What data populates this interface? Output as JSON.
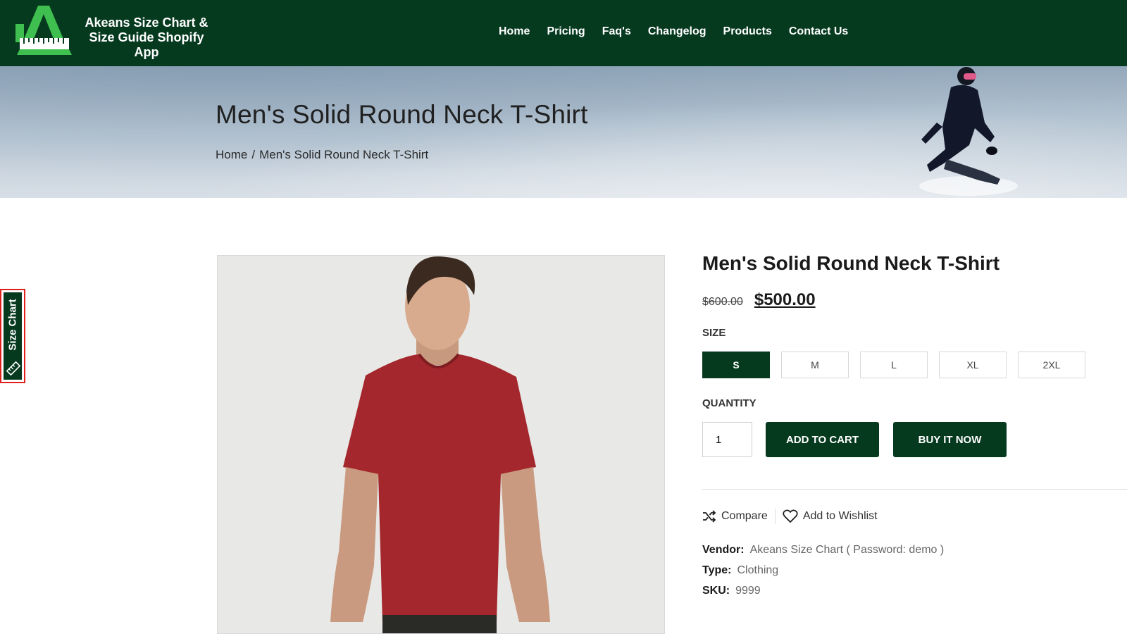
{
  "header": {
    "logo_line1": "Akeans Size Chart &",
    "logo_line2": "Size Guide Shopify App",
    "nav": [
      "Home",
      "Pricing",
      "Faq's",
      "Changelog",
      "Products",
      "Contact Us"
    ]
  },
  "banner": {
    "title": "Men's Solid Round Neck T-Shirt",
    "breadcrumb_home": "Home",
    "breadcrumb_sep": "/",
    "breadcrumb_current": "Men's Solid Round Neck T-Shirt"
  },
  "size_chart_tab": {
    "label": "Size Chart"
  },
  "product": {
    "title": "Men's Solid Round Neck T-Shirt",
    "old_price": "$600.00",
    "price": "$500.00",
    "size_label": "SIZE",
    "sizes": [
      "S",
      "M",
      "L",
      "XL",
      "2XL"
    ],
    "selected_size": "S",
    "quantity_label": "QUANTITY",
    "quantity": "1",
    "add_to_cart": "ADD TO CART",
    "buy_now": "BUY IT NOW",
    "compare": "Compare",
    "wishlist": "Add to Wishlist",
    "vendor_label": "Vendor:",
    "vendor": "Akeans Size Chart ( Password: demo )",
    "type_label": "Type:",
    "type": "Clothing",
    "sku_label": "SKU:",
    "sku": "9999"
  },
  "colors": {
    "brand_green": "#063a1f",
    "highlight_red": "#e0201c"
  }
}
